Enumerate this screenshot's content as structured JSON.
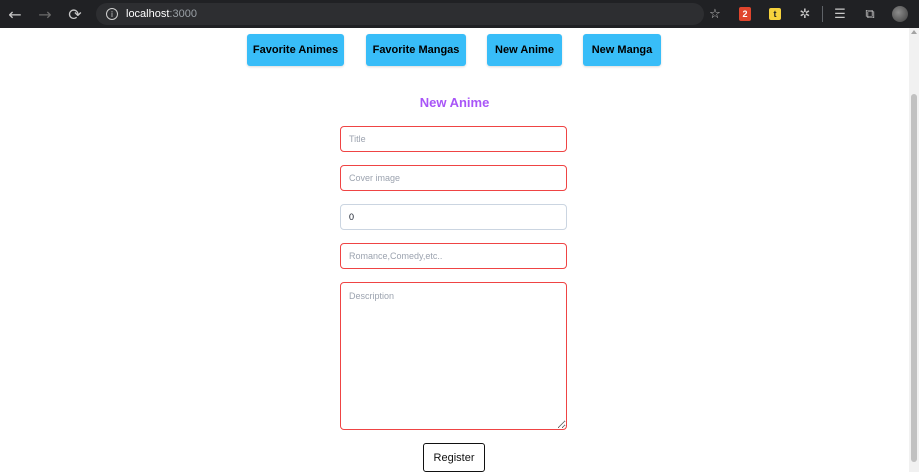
{
  "browser": {
    "url_host": "localhost",
    "url_port": ":3000",
    "nav_back": "←",
    "nav_forward": "→",
    "nav_reload": "⟳"
  },
  "nav": {
    "buttons": [
      {
        "label": "Favorite Animes"
      },
      {
        "label": "Favorite Mangas"
      },
      {
        "label": "New Anime"
      },
      {
        "label": "New Manga"
      }
    ],
    "button_color": "#38bdf8"
  },
  "form": {
    "title": "New Anime",
    "title_color": "#a855f7",
    "fields": {
      "title": {
        "placeholder": "Title",
        "value": ""
      },
      "cover_image": {
        "placeholder": "Cover image",
        "value": ""
      },
      "episodes": {
        "placeholder": "",
        "value": "0"
      },
      "genres": {
        "placeholder": "Romance,Comedy,etc..",
        "value": ""
      },
      "description": {
        "placeholder": "Description",
        "value": ""
      }
    },
    "submit_label": "Register",
    "invalid_border_color": "#ef4444"
  }
}
